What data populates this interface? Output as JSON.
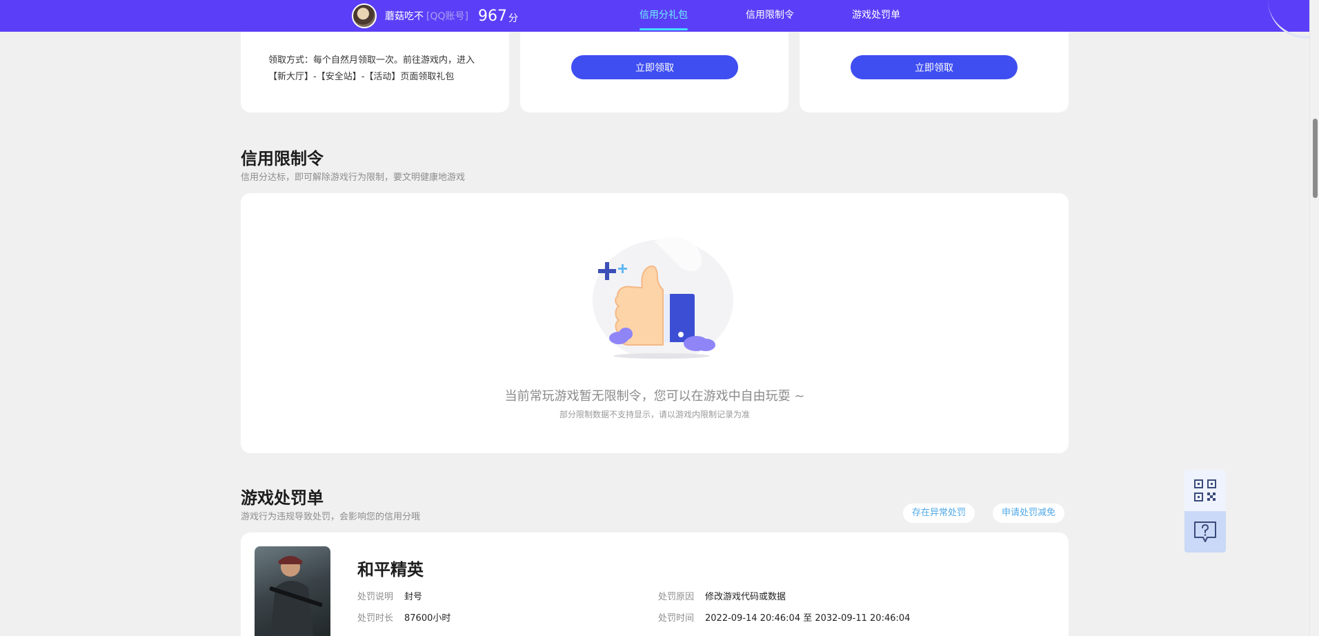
{
  "header": {
    "username": "蘑菇吃不",
    "account_type": "[QQ账号]",
    "score": "967",
    "score_unit": "分",
    "tabs": [
      {
        "label": "信用分礼包",
        "active": true
      },
      {
        "label": "信用限制令",
        "active": false
      },
      {
        "label": "游戏处罚单",
        "active": false
      }
    ]
  },
  "gifts": {
    "card1_desc": "领取方式：每个自然月领取一次。前往游戏内，进入【新大厅】-【安全站】-【活动】页面领取礼包",
    "card2_button": "立即领取",
    "card3_button": "立即领取"
  },
  "restriction": {
    "title": "信用限制令",
    "subtitle": "信用分达标，即可解除游戏行为限制，要文明健康地游戏",
    "empty_text": "当前常玩游戏暂无限制令，您可以在游戏中自由玩耍 ~",
    "empty_note": "部分限制数据不支持显示，请以游戏内限制记录为准"
  },
  "penalty": {
    "title": "游戏处罚单",
    "subtitle": "游戏行为违规导致处罚，会影响您的信用分哦",
    "actions": [
      "存在异常处罚",
      "申请处罚减免"
    ],
    "game_name": "和平精英",
    "fields": {
      "desc_label": "处罚说明",
      "desc_value": "封号",
      "duration_label": "处罚时长",
      "duration_value": "87600小时",
      "reason_label": "处罚原因",
      "reason_value": "修改游戏代码或数据",
      "time_label": "处罚时间",
      "time_value": "2022-09-14 20:46:04 至 2032-09-11 20:46:04"
    }
  },
  "colors": {
    "nav_bg": "#5b3ff8",
    "active_tab": "#6ff0ff",
    "button_primary": "#3f4ef0",
    "link": "#4fa8e8"
  },
  "icons": {
    "qr": "qr-code-icon",
    "help": "help-chat-icon",
    "illustration": "thumbs-up-illustration"
  }
}
